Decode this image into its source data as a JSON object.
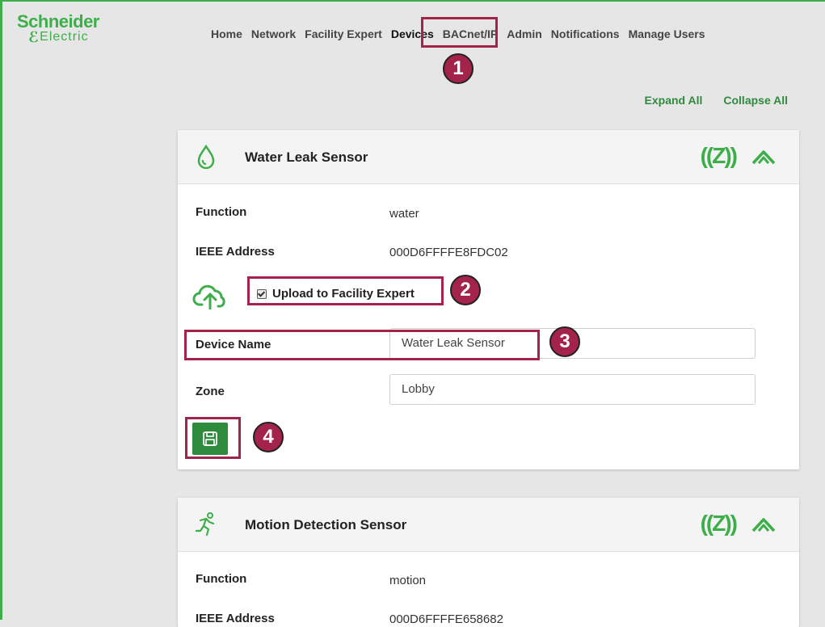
{
  "brand": {
    "name_top": "Schneider",
    "name_bottom": "Electric",
    "accent": "#3dae4a",
    "callout": "#a4234a"
  },
  "nav": {
    "items": [
      "Home",
      "Network",
      "Facility Expert",
      "Devices",
      "BACnet/IP",
      "Admin",
      "Notifications",
      "Manage Users"
    ],
    "active": "Devices"
  },
  "links": {
    "expand_all": "Expand All",
    "collapse_all": "Collapse All"
  },
  "callouts": [
    "1",
    "2",
    "3",
    "4"
  ],
  "cards": [
    {
      "title": "Water Leak Sensor",
      "icon": "water-drop-icon",
      "status_icon_text": "((Z))",
      "labels": {
        "function": "Function",
        "ieee": "IEEE Address",
        "upload": "Upload to Facility Expert",
        "device_name": "Device Name",
        "zone": "Zone"
      },
      "function": "water",
      "ieee_address": "000D6FFFFE8FDC02",
      "upload_checked": true,
      "device_name_value": "Water Leak Sensor",
      "zone_value": "Lobby"
    },
    {
      "title": "Motion Detection Sensor",
      "icon": "running-person-icon",
      "status_icon_text": "((Z))",
      "labels": {
        "function": "Function",
        "ieee": "IEEE Address"
      },
      "function": "motion",
      "ieee_address": "000D6FFFFE658682"
    }
  ]
}
